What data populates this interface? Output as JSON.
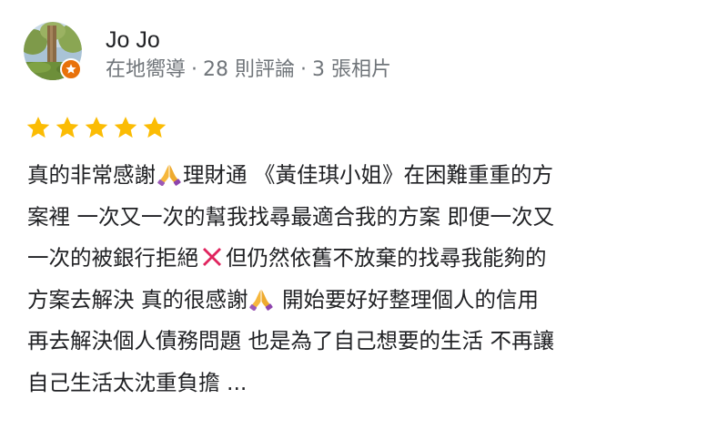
{
  "reviewer": {
    "name": "Jo Jo",
    "role": "在地嚮導",
    "reviews_count": "28 則評論",
    "photos_count": "3 張相片",
    "separator": "·",
    "badge_color": "#e8710a"
  },
  "rating": {
    "stars": 5,
    "max": 5,
    "color": "#fbbc04"
  },
  "review": {
    "lines": [
      [
        "真的非常感謝",
        "{pray}",
        "理財通 《黃佳琪小姐》在困難重重的方"
      ],
      [
        "案裡 一次又一次的幫我找尋最適合我的方案 即便一次又"
      ],
      [
        "一次的被銀行拒絕",
        "{cross}",
        "但仍然依舊不放棄的找尋我能夠的"
      ],
      [
        "方案去解決 真的很感謝",
        "{pray}",
        " 開始要好好整理個人的信用"
      ],
      [
        "再去解決個人債務問題 也是為了自己想要的生活 不再讓"
      ],
      [
        "自己生活太沈重負擔 ",
        "{more}"
      ]
    ],
    "more_label": "...",
    "emoji_icons": {
      "pray": "folded-hands-emoji",
      "cross": "cross-mark-emoji"
    }
  }
}
